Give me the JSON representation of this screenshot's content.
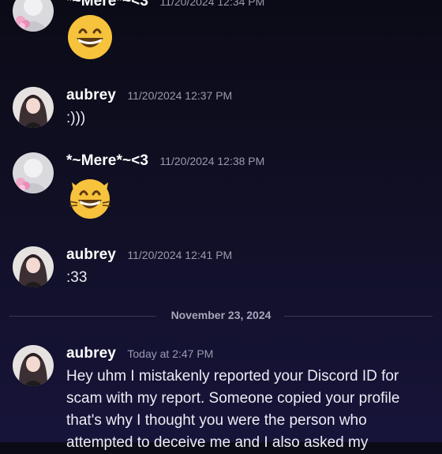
{
  "messages": [
    {
      "username": "*~Mere*~<3",
      "timestamp": "11/20/2024 12:34 PM",
      "content": "",
      "emoji": "grinning-face"
    },
    {
      "username": "aubrey",
      "timestamp": "11/20/2024 12:37 PM",
      "content": ":)))"
    },
    {
      "username": "*~Mere*~<3",
      "timestamp": "11/20/2024 12:38 PM",
      "content": "",
      "emoji": "grinning-cat-face"
    },
    {
      "username": "aubrey",
      "timestamp": "11/20/2024 12:41 PM",
      "content": ":33"
    },
    {
      "username": "aubrey",
      "timestamp": "Today at 2:47 PM",
      "content": "Hey uhm I mistakenly reported your Discord ID for scam with my report. Someone copied your profile that's why I thought you were the person who attempted to deceive me and I also asked my"
    }
  ],
  "date_divider": "November 23, 2024",
  "colors": {
    "background_top": "#0b0b17",
    "background_bottom": "#17143a",
    "username": "#ffffff",
    "timestamp": "#9a9aae",
    "divider_line": "#3a3a52",
    "emoji_yellow": "#f7c23c"
  }
}
